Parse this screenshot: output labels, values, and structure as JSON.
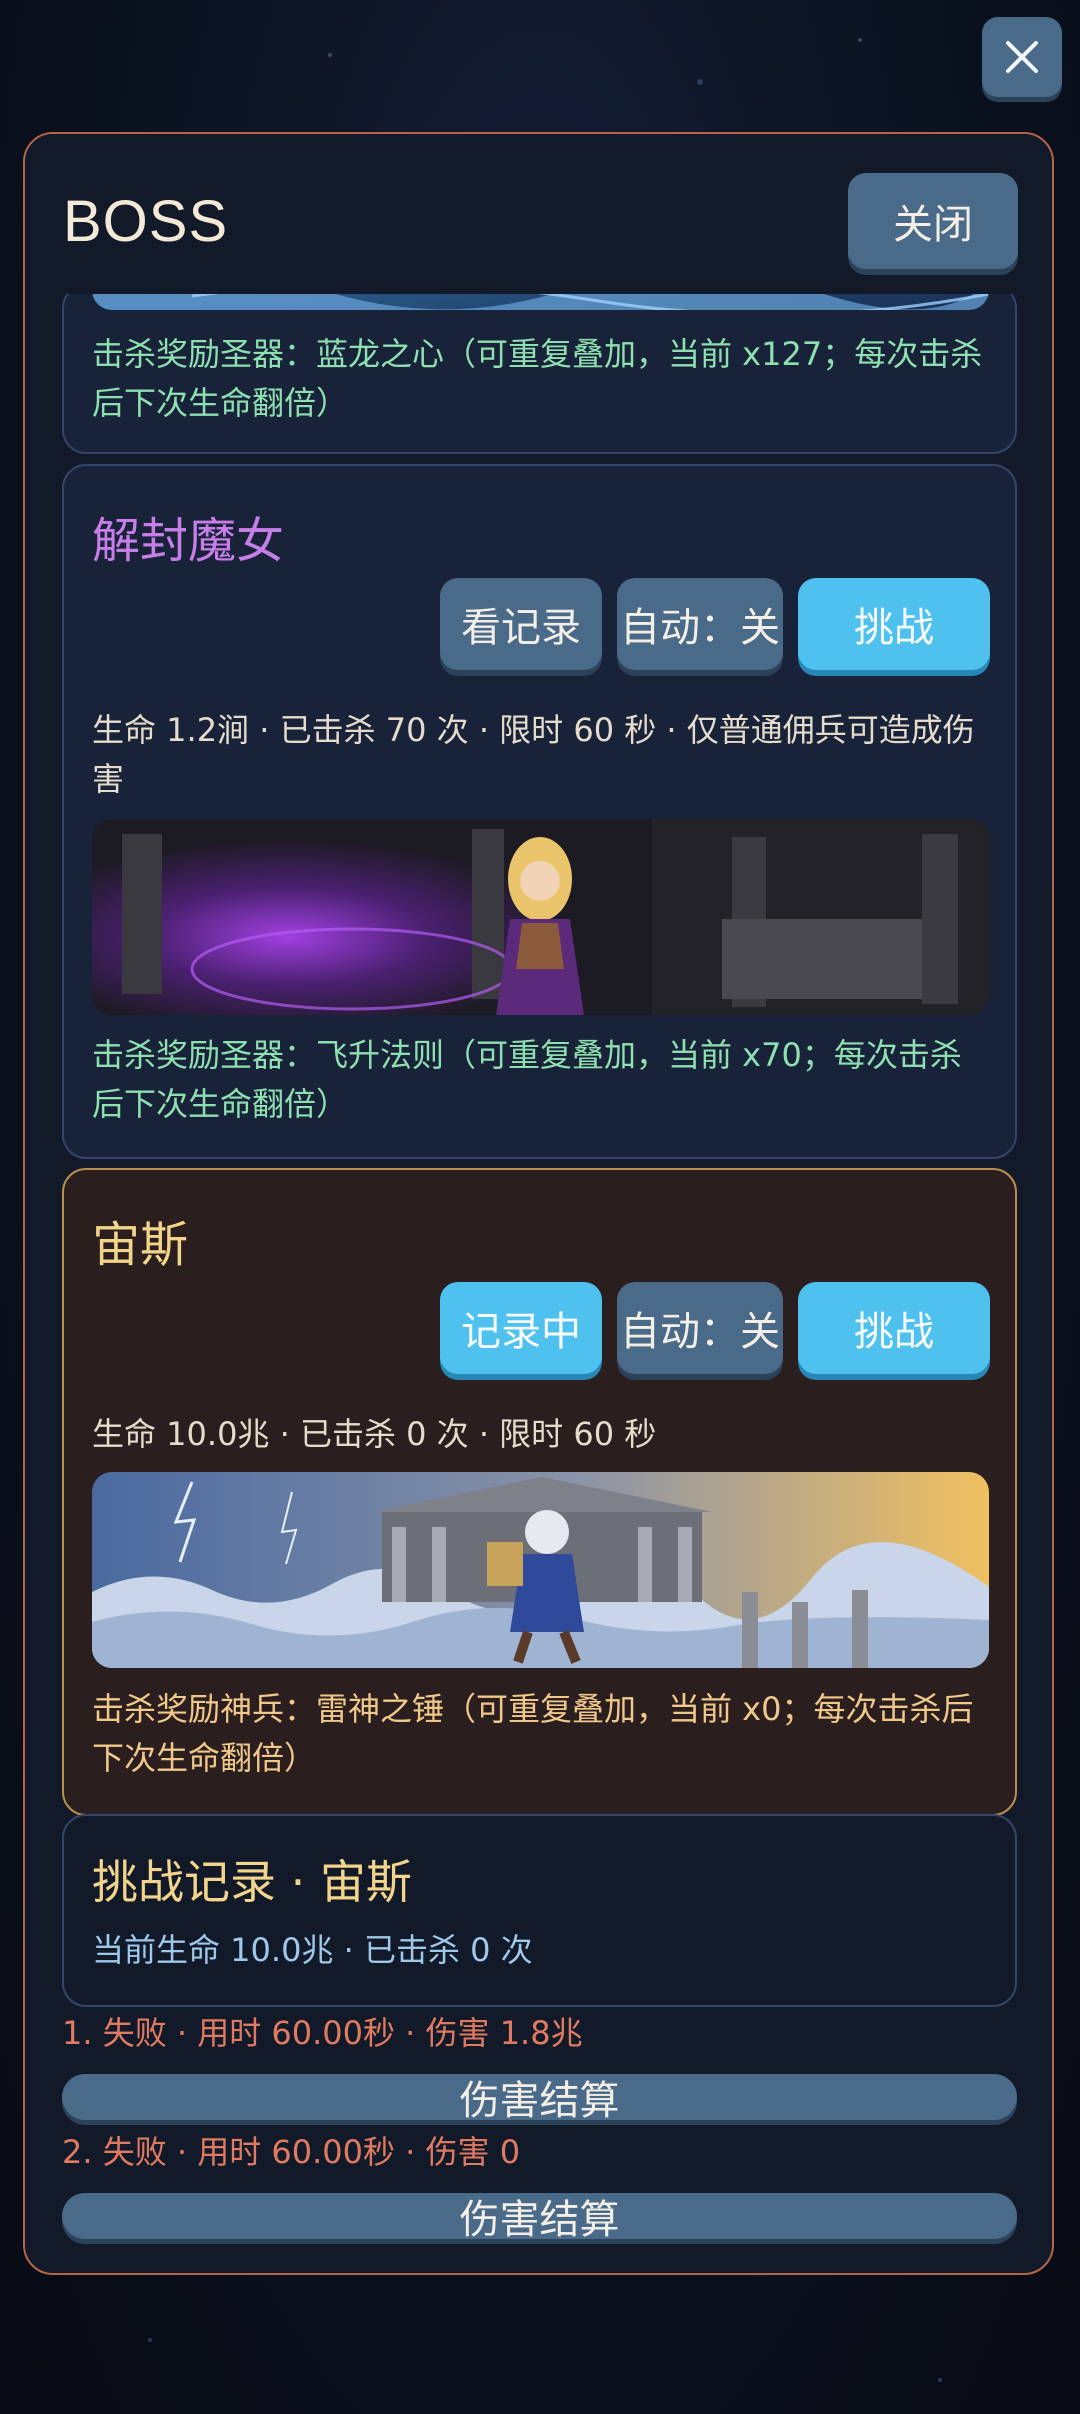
{
  "modal": {
    "title": "BOSS",
    "close_label": "关闭"
  },
  "boss_top": {
    "reward": "击杀奖励圣器：蓝龙之心（可重复叠加，当前 x127；每次击杀后下次生命翻倍）"
  },
  "boss_witch": {
    "name": "解封魔女",
    "btn_record": "看记录",
    "btn_auto": "自动：关",
    "btn_challenge": "挑战",
    "info": "生命 1.2涧 · 已击杀 70 次 · 限时 60 秒 · 仅普通佣兵可造成伤害",
    "reward": "击杀奖励圣器：飞升法则（可重复叠加，当前 x70；每次击杀后下次生命翻倍）"
  },
  "boss_zeus": {
    "name": "宙斯",
    "btn_record": "记录中",
    "btn_auto": "自动：关",
    "btn_challenge": "挑战",
    "info": "生命 10.0兆 · 已击杀 0 次 · 限时 60 秒",
    "reward": "击杀奖励神兵：雷神之锤（可重复叠加，当前 x0；每次击杀后下次生命翻倍）"
  },
  "log": {
    "title": "挑战记录 · 宙斯",
    "subtitle": "当前生命 10.0兆 · 已击杀 0 次",
    "entries": [
      {
        "text": "1. 失败 · 用时 60.00秒 · 伤害 1.8兆",
        "button": "伤害结算"
      },
      {
        "text": "2. 失败 · 用时 60.00秒 · 伤害 0",
        "button": "伤害结算"
      }
    ]
  },
  "colors": {
    "accent_cyan": "#4fc1ef",
    "button_slate": "#4a6a8a",
    "witch_name": "#c77ee8",
    "zeus_name": "#f2d48a",
    "reward_green": "#8ee0b0",
    "reward_gold": "#f0c98a",
    "record_fail": "#e07b61"
  },
  "icons": {
    "close": "close-icon"
  }
}
